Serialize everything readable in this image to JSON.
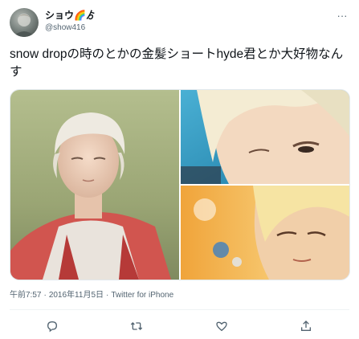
{
  "author": {
    "display_name": "ショウ🌈ゟ",
    "handle": "@show416",
    "avatar_icon": "user-avatar"
  },
  "tweet": {
    "text": "snow dropの時のとかの金髪ショートhyde君とか大好物なんす",
    "time": "午前7:57",
    "separator": "·",
    "date": "2016年11月5日",
    "source": "Twitter for iPhone"
  },
  "media": {
    "photos": [
      {
        "icon": "photo-blond-short-hair-pink-jacket"
      },
      {
        "icon": "photo-blond-closeup-blue-background"
      },
      {
        "icon": "photo-blond-portrait-orange-background"
      }
    ]
  },
  "actions": [
    {
      "icon": "reply-icon"
    },
    {
      "icon": "retweet-icon"
    },
    {
      "icon": "like-icon"
    },
    {
      "icon": "share-icon"
    }
  ],
  "colors": {
    "text": "#0f1419",
    "secondary": "#536471",
    "divider": "#eff3f4"
  }
}
